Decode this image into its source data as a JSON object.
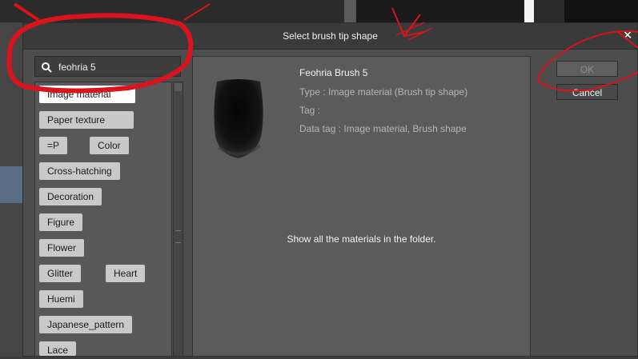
{
  "dialog": {
    "title": "Select brush tip shape",
    "close_icon": "close-icon"
  },
  "search": {
    "value": "feohria 5",
    "icon": "search-icon"
  },
  "tags": [
    {
      "label": "Image material",
      "selected": true
    },
    {
      "label": "Paper texture"
    },
    {
      "label": "=P"
    },
    {
      "label": "Color"
    },
    {
      "label": "Cross-hatching"
    },
    {
      "label": "Decoration"
    },
    {
      "label": "Figure"
    },
    {
      "label": "Flower"
    },
    {
      "label": "Glitter"
    },
    {
      "label": "Heart"
    },
    {
      "label": "Huemi"
    },
    {
      "label": "Japanese_pattern"
    },
    {
      "label": "Lace"
    }
  ],
  "material": {
    "name": "Feohria Brush 5",
    "type": "Type : Image material (Brush tip shape)",
    "tag": "Tag :",
    "data_tag": "Data tag : Image material, Brush shape",
    "folder_message": "Show all the materials in the folder."
  },
  "buttons": {
    "ok": "OK",
    "cancel": "Cancel"
  },
  "colors": {
    "annotation": "#d9141c",
    "dialog_bg": "#4d4d4d",
    "tag_bg": "#c9c9c9"
  }
}
